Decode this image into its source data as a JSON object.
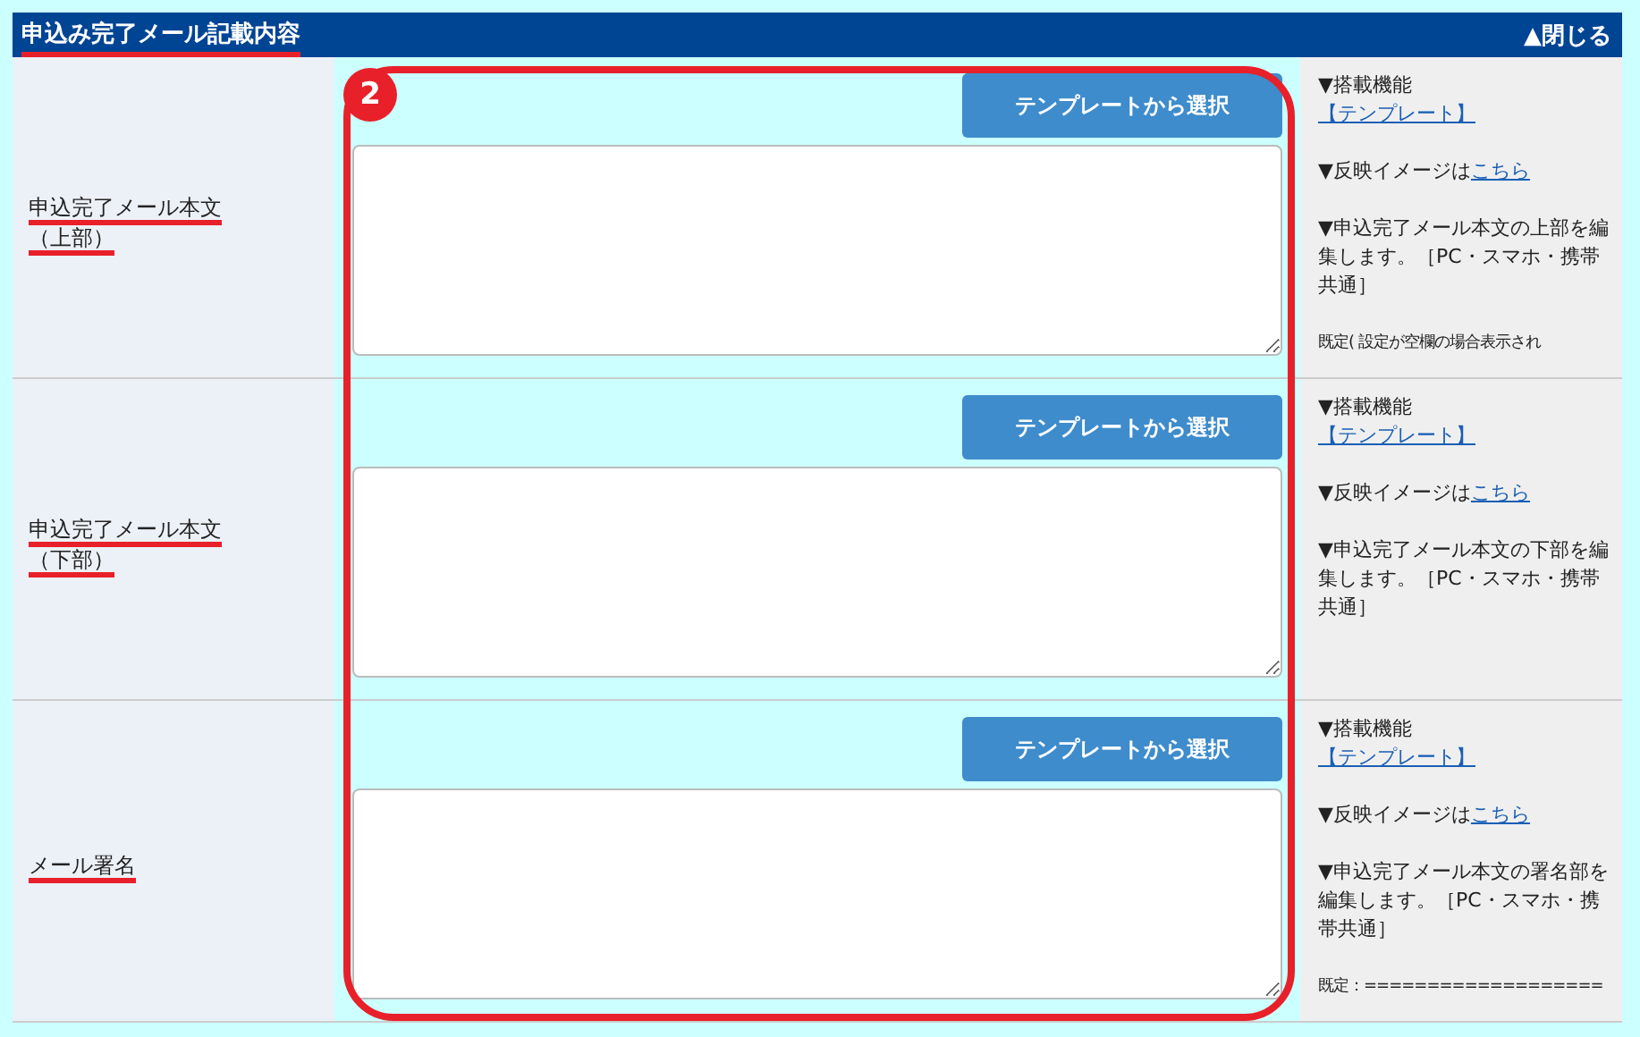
{
  "section": {
    "title": "申込み完了メール記載内容",
    "title_highlighted": true,
    "toggle": "▲閉じる"
  },
  "annotation": {
    "badge": "2"
  },
  "rows": [
    {
      "label": "申込完了メール本文",
      "sublabel": "（上部）",
      "highlighted": true,
      "button": "テンプレートから選択",
      "help": {
        "feature_heading": "▼搭載機能",
        "feature_link": "【テンプレート】",
        "preview_prefix": "▼反映イメージは",
        "preview_link": "こちら",
        "description": "▼申込完了メール本文の上部を編集します。［PC・スマホ・携帯共通］",
        "default": "既定( 設定が空欄の場合表示され"
      }
    },
    {
      "label": "申込完了メール本文",
      "sublabel": "（下部）",
      "highlighted": true,
      "button": "テンプレートから選択",
      "help": {
        "feature_heading": "▼搭載機能",
        "feature_link": "【テンプレート】",
        "preview_prefix": "▼反映イメージは",
        "preview_link": "こちら",
        "description": "▼申込完了メール本文の下部を編集します。［PC・スマホ・携帯共通］"
      }
    },
    {
      "label": "メール署名",
      "highlighted": true,
      "button": "テンプレートから選択",
      "help": {
        "feature_heading": "▼搭載機能",
        "feature_link": "【テンプレート】",
        "preview_prefix": "▼反映イメージは",
        "preview_link": "こちら",
        "description": "▼申込完了メール本文の署名部を編集します。［PC・スマホ・携帯共通］",
        "default": "既定：==================="
      }
    }
  ]
}
